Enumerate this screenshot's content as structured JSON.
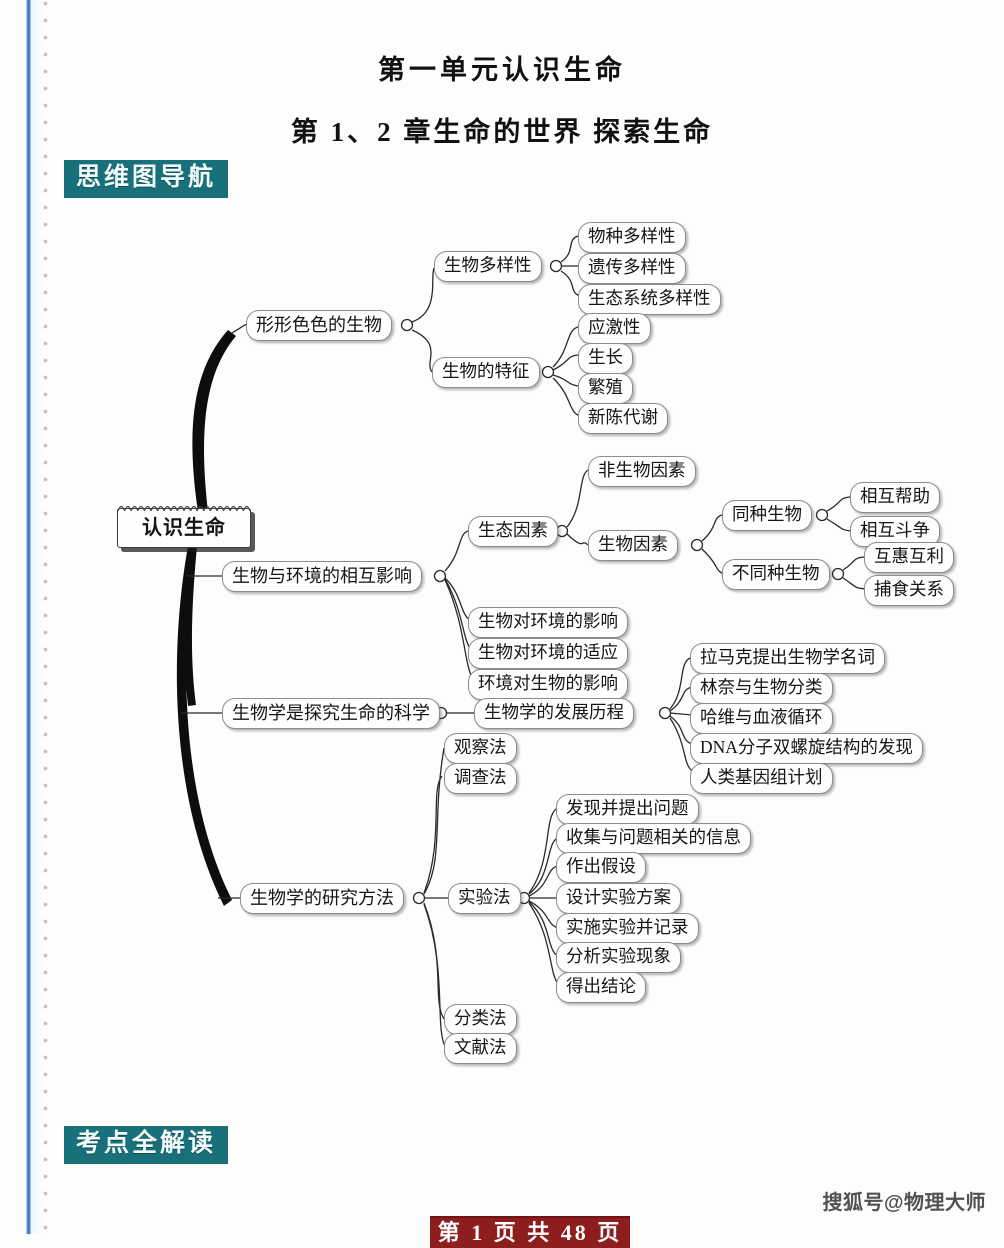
{
  "document": {
    "title_line_1": "第一单元认识生命",
    "title_line_2": "第 1、2 章生命的世界   探索生命"
  },
  "banners": {
    "nav": "思维图导航",
    "key_points": "考点全解读",
    "color": "#17707a"
  },
  "footer": {
    "page_banner": "第 1 页 共 48 页",
    "page_banner_color": "#8e1d1d",
    "watermark": "搜狐号@物理大师"
  },
  "mindmap": {
    "root": "认识生命",
    "nodes": {
      "b1": "形形色色的生物",
      "b1_1": "生物多样性",
      "b1_1_1": "物种多样性",
      "b1_1_2": "遗传多样性",
      "b1_1_3": "生态系统多样性",
      "b1_2": "生物的特征",
      "b1_2_1": "应激性",
      "b1_2_2": "生长",
      "b1_2_3": "繁殖",
      "b1_2_4": "新陈代谢",
      "b2": "生物与环境的相互影响",
      "b2_1": "生态因素",
      "b2_1_1": "非生物因素",
      "b2_1_2": "生物因素",
      "b2_1_2_1": "同种生物",
      "b2_1_2_1_1": "相互帮助",
      "b2_1_2_1_2": "相互斗争",
      "b2_1_2_2": "不同种生物",
      "b2_1_2_2_1": "互惠互利",
      "b2_1_2_2_2": "捕食关系",
      "b2_2": "生物对环境的影响",
      "b2_3": "生物对环境的适应",
      "b2_4": "环境对生物的影响",
      "b3": "生物学是探究生命的科学",
      "b3_1": "生物学的发展历程",
      "b3_1_1": "拉马克提出生物学名词",
      "b3_1_2": "林奈与生物分类",
      "b3_1_3": "哈维与血液循环",
      "b3_1_4": "DNA分子双螺旋结构的发现",
      "b3_1_5": "人类基因组计划",
      "b4": "生物学的研究方法",
      "b4_1": "观察法",
      "b4_2": "调查法",
      "b4_3": "实验法",
      "b4_3_1": "发现并提出问题",
      "b4_3_2": "收集与问题相关的信息",
      "b4_3_3": "作出假设",
      "b4_3_4": "设计实验方案",
      "b4_3_5": "实施实验并记录",
      "b4_3_6": "分析实验现象",
      "b4_3_7": "得出结论",
      "b4_4": "分类法",
      "b4_5": "文献法"
    }
  }
}
